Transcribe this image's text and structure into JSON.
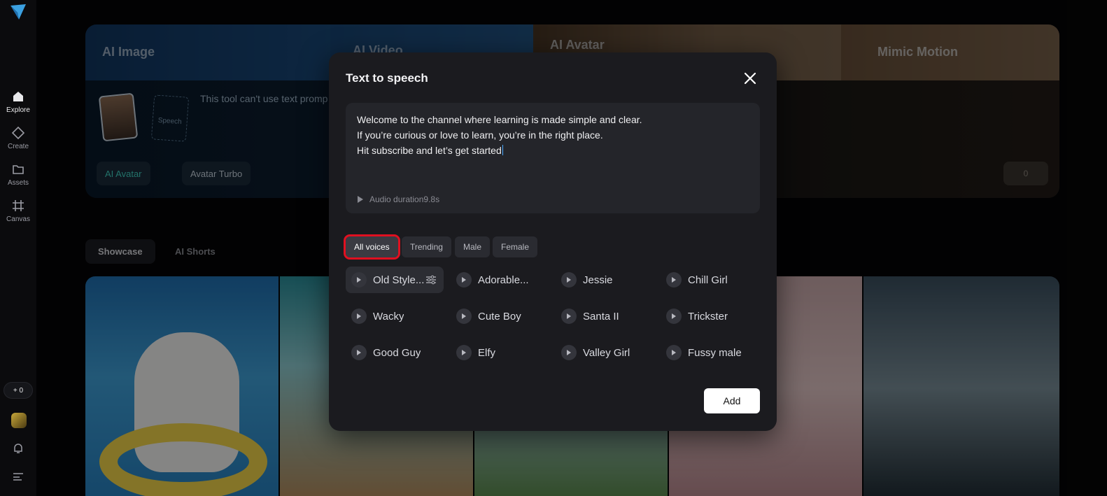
{
  "sidebar": {
    "items": [
      {
        "label": "Explore",
        "icon": "home-icon"
      },
      {
        "label": "Create",
        "icon": "diamond-icon"
      },
      {
        "label": "Assets",
        "icon": "folder-icon"
      },
      {
        "label": "Canvas",
        "icon": "grid-icon"
      }
    ],
    "credits": "+ 0"
  },
  "banner": {
    "tabs": [
      "AI Image",
      "AI Video",
      "AI Avatar",
      "Mimic Motion"
    ],
    "hint": "This tool can't use text promp",
    "speech_card": "Speech",
    "mode_button": "AI Avatar",
    "turbo_button": "Avatar Turbo",
    "generate_count": "0"
  },
  "sections": [
    "Showcase",
    "AI Shorts"
  ],
  "modal": {
    "title": "Text to speech",
    "text_lines": [
      "Welcome to the channel where learning is made simple and clear.",
      "If you’re curious or love to learn, you’re in the right place.",
      "Hit subscribe and let’s get started"
    ],
    "duration": "Audio duration9.8s",
    "filters": [
      "All voices",
      "Trending",
      "Male",
      "Female"
    ],
    "voices": [
      [
        "Old Style...",
        "Adorable...",
        "Jessie",
        "Chill Girl"
      ],
      [
        "Wacky",
        "Cute Boy",
        "Santa II",
        "Trickster"
      ],
      [
        "Good Guy",
        "Elfy",
        "Valley Girl",
        "Fussy male"
      ]
    ],
    "add_button": "Add"
  }
}
